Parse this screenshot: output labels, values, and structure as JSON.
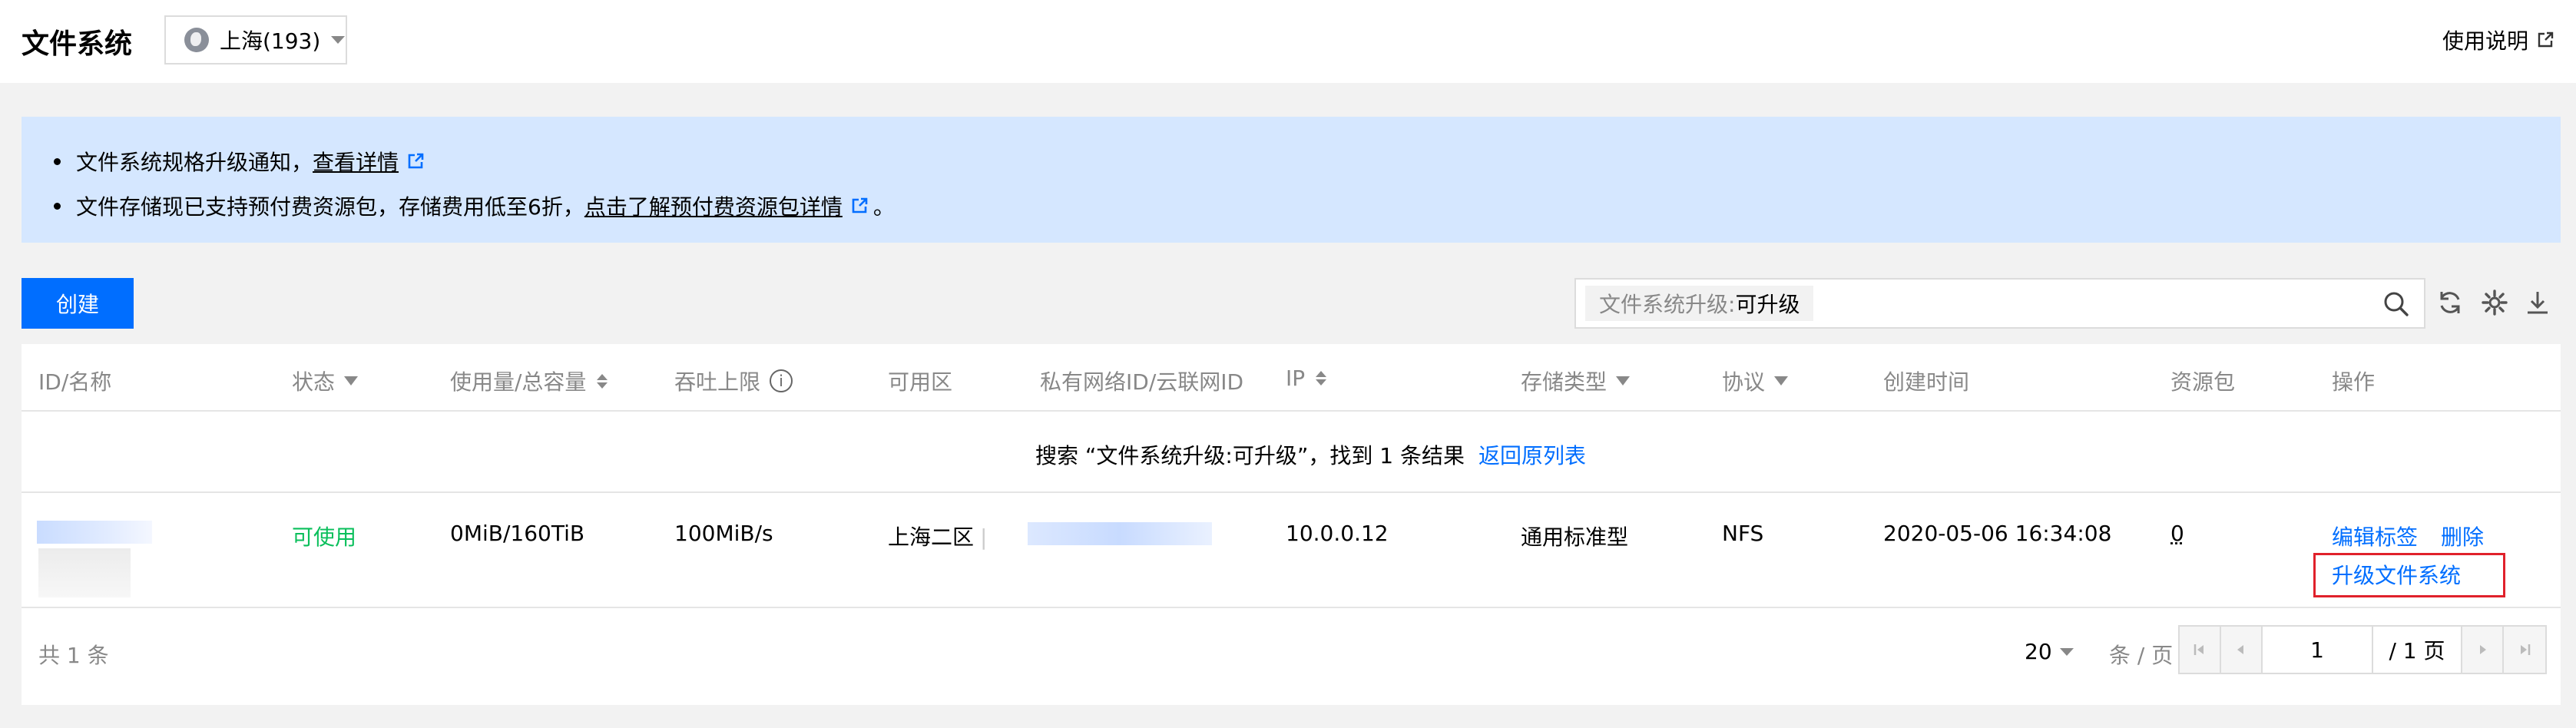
{
  "header": {
    "title": "文件系统",
    "region": "上海(193)",
    "help": "使用说明"
  },
  "notice": {
    "line1_text": "文件系统规格升级通知，",
    "line1_link": "查看详情",
    "line2_text": "文件存储现已支持预付费资源包，存储费用低至6折，",
    "line2_link": "点击了解预付费资源包详情",
    "line2_suffix": "。"
  },
  "toolbar": {
    "create_label": "创建",
    "search_tag_key": "文件系统升级:",
    "search_tag_value": "可升级"
  },
  "table": {
    "columns": [
      "ID/名称",
      "状态",
      "使用量/总容量",
      "吞吐上限",
      "可用区",
      "私有网络ID/云联网ID",
      "IP",
      "存储类型",
      "协议",
      "创建时间",
      "资源包",
      "操作"
    ],
    "search_result_text": "搜索 “文件系统升级:可升级”，找到 1 条结果",
    "back_link": "返回原列表",
    "rows": [
      {
        "status": "可使用",
        "usage": "0MiB/160TiB",
        "throughput": "100MiB/s",
        "zone": "上海二区",
        "ip": "10.0.0.12",
        "storage_type": "通用标准型",
        "protocol": "NFS",
        "created": "2020-05-06 16:34:08",
        "resource_pack": "0",
        "actions": {
          "edit_tags": "编辑标签",
          "delete": "删除",
          "upgrade": "升级文件系统"
        }
      }
    ]
  },
  "footer": {
    "total": "共 1 条",
    "page_size": "20",
    "per_page": "条 / 页",
    "current_page": "1",
    "total_pages": "/ 1 页"
  },
  "colors": {
    "primary": "#006eff",
    "available": "#0abf5b",
    "notice_bg": "#d5e7ff",
    "highlight_box": "#e0212b"
  }
}
